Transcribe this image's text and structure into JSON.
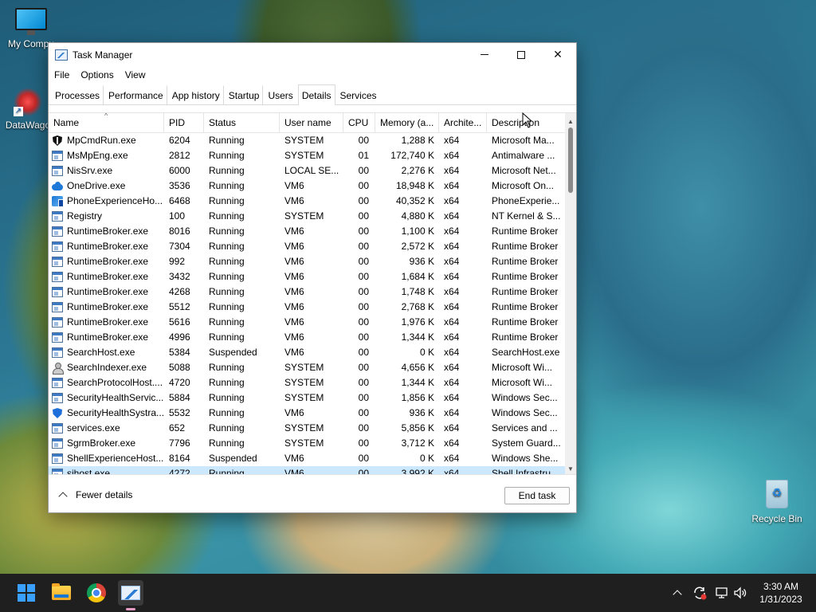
{
  "desktop": {
    "icons": [
      {
        "label": "My Compu",
        "icon": "computer-icon"
      },
      {
        "label": "DataWago",
        "icon": "datawagon-icon"
      },
      {
        "label": "Recycle Bin",
        "icon": "recycle-bin-icon"
      }
    ]
  },
  "window": {
    "title": "Task Manager",
    "controls": {
      "minimize": "minimize-icon",
      "maximize": "maximize-icon",
      "close_glyph": "✕"
    },
    "menu": [
      "File",
      "Options",
      "View"
    ],
    "tabs": [
      "Processes",
      "Performance",
      "App history",
      "Startup",
      "Users",
      "Details",
      "Services"
    ],
    "active_tab": "Details"
  },
  "table": {
    "columns": [
      "Name",
      "PID",
      "Status",
      "User name",
      "CPU",
      "Memory (a...",
      "Archite...",
      "Description"
    ],
    "sort_indicator": "^",
    "rows": [
      {
        "name": "MpCmdRun.exe",
        "pid": "6204",
        "status": "Running",
        "user": "SYSTEM",
        "cpu": "00",
        "mem": "1,288 K",
        "arch": "x64",
        "desc": "Microsoft Ma...",
        "icon": "shield-black"
      },
      {
        "name": "MsMpEng.exe",
        "pid": "2812",
        "status": "Running",
        "user": "SYSTEM",
        "cpu": "01",
        "mem": "172,740 K",
        "arch": "x64",
        "desc": "Antimalware ...",
        "icon": "app"
      },
      {
        "name": "NisSrv.exe",
        "pid": "6000",
        "status": "Running",
        "user": "LOCAL SE...",
        "cpu": "00",
        "mem": "2,276 K",
        "arch": "x64",
        "desc": "Microsoft Net...",
        "icon": "app"
      },
      {
        "name": "OneDrive.exe",
        "pid": "3536",
        "status": "Running",
        "user": "VM6",
        "cpu": "00",
        "mem": "18,948 K",
        "arch": "x64",
        "desc": "Microsoft On...",
        "icon": "cloud"
      },
      {
        "name": "PhoneExperienceHo...",
        "pid": "6468",
        "status": "Running",
        "user": "VM6",
        "cpu": "00",
        "mem": "40,352 K",
        "arch": "x64",
        "desc": "PhoneExperie...",
        "icon": "phone"
      },
      {
        "name": "Registry",
        "pid": "100",
        "status": "Running",
        "user": "SYSTEM",
        "cpu": "00",
        "mem": "4,880 K",
        "arch": "x64",
        "desc": "NT Kernel & S...",
        "icon": "app"
      },
      {
        "name": "RuntimeBroker.exe",
        "pid": "8016",
        "status": "Running",
        "user": "VM6",
        "cpu": "00",
        "mem": "1,100 K",
        "arch": "x64",
        "desc": "Runtime Broker",
        "icon": "app"
      },
      {
        "name": "RuntimeBroker.exe",
        "pid": "7304",
        "status": "Running",
        "user": "VM6",
        "cpu": "00",
        "mem": "2,572 K",
        "arch": "x64",
        "desc": "Runtime Broker",
        "icon": "app"
      },
      {
        "name": "RuntimeBroker.exe",
        "pid": "992",
        "status": "Running",
        "user": "VM6",
        "cpu": "00",
        "mem": "936 K",
        "arch": "x64",
        "desc": "Runtime Broker",
        "icon": "app"
      },
      {
        "name": "RuntimeBroker.exe",
        "pid": "3432",
        "status": "Running",
        "user": "VM6",
        "cpu": "00",
        "mem": "1,684 K",
        "arch": "x64",
        "desc": "Runtime Broker",
        "icon": "app"
      },
      {
        "name": "RuntimeBroker.exe",
        "pid": "4268",
        "status": "Running",
        "user": "VM6",
        "cpu": "00",
        "mem": "1,748 K",
        "arch": "x64",
        "desc": "Runtime Broker",
        "icon": "app"
      },
      {
        "name": "RuntimeBroker.exe",
        "pid": "5512",
        "status": "Running",
        "user": "VM6",
        "cpu": "00",
        "mem": "2,768 K",
        "arch": "x64",
        "desc": "Runtime Broker",
        "icon": "app"
      },
      {
        "name": "RuntimeBroker.exe",
        "pid": "5616",
        "status": "Running",
        "user": "VM6",
        "cpu": "00",
        "mem": "1,976 K",
        "arch": "x64",
        "desc": "Runtime Broker",
        "icon": "app"
      },
      {
        "name": "RuntimeBroker.exe",
        "pid": "4996",
        "status": "Running",
        "user": "VM6",
        "cpu": "00",
        "mem": "1,344 K",
        "arch": "x64",
        "desc": "Runtime Broker",
        "icon": "app"
      },
      {
        "name": "SearchHost.exe",
        "pid": "5384",
        "status": "Suspended",
        "user": "VM6",
        "cpu": "00",
        "mem": "0 K",
        "arch": "x64",
        "desc": "SearchHost.exe",
        "icon": "app"
      },
      {
        "name": "SearchIndexer.exe",
        "pid": "5088",
        "status": "Running",
        "user": "SYSTEM",
        "cpu": "00",
        "mem": "4,656 K",
        "arch": "x64",
        "desc": "Microsoft Wi...",
        "icon": "user"
      },
      {
        "name": "SearchProtocolHost....",
        "pid": "4720",
        "status": "Running",
        "user": "SYSTEM",
        "cpu": "00",
        "mem": "1,344 K",
        "arch": "x64",
        "desc": "Microsoft Wi...",
        "icon": "app"
      },
      {
        "name": "SecurityHealthServic...",
        "pid": "5884",
        "status": "Running",
        "user": "SYSTEM",
        "cpu": "00",
        "mem": "1,856 K",
        "arch": "x64",
        "desc": "Windows Sec...",
        "icon": "app"
      },
      {
        "name": "SecurityHealthSystra...",
        "pid": "5532",
        "status": "Running",
        "user": "VM6",
        "cpu": "00",
        "mem": "936 K",
        "arch": "x64",
        "desc": "Windows Sec...",
        "icon": "blue-shield"
      },
      {
        "name": "services.exe",
        "pid": "652",
        "status": "Running",
        "user": "SYSTEM",
        "cpu": "00",
        "mem": "5,856 K",
        "arch": "x64",
        "desc": "Services and ...",
        "icon": "app"
      },
      {
        "name": "SgrmBroker.exe",
        "pid": "7796",
        "status": "Running",
        "user": "SYSTEM",
        "cpu": "00",
        "mem": "3,712 K",
        "arch": "x64",
        "desc": "System Guard...",
        "icon": "app"
      },
      {
        "name": "ShellExperienceHost....",
        "pid": "8164",
        "status": "Suspended",
        "user": "VM6",
        "cpu": "00",
        "mem": "0 K",
        "arch": "x64",
        "desc": "Windows She...",
        "icon": "app"
      },
      {
        "name": "sihost.exe",
        "pid": "4272",
        "status": "Running",
        "user": "VM6",
        "cpu": "00",
        "mem": "3,992 K",
        "arch": "x64",
        "desc": "Shell Infrastru...",
        "icon": "app",
        "selected": true
      }
    ]
  },
  "footer": {
    "fewer_details": "Fewer details",
    "end_task": "End task"
  },
  "taskbar": {
    "apps": [
      "start-icon",
      "file-explorer-icon",
      "chrome-icon",
      "task-manager-icon"
    ],
    "tray": [
      "show-hidden-icons-chevron",
      "sync-icon",
      "network-icon",
      "volume-icon"
    ],
    "time": "3:30 AM",
    "date": "1/31/2023"
  },
  "colors": {
    "selected_row": "#cce8ff",
    "taskbar": "#1f1f1f",
    "accent": "#3aa0ff"
  }
}
